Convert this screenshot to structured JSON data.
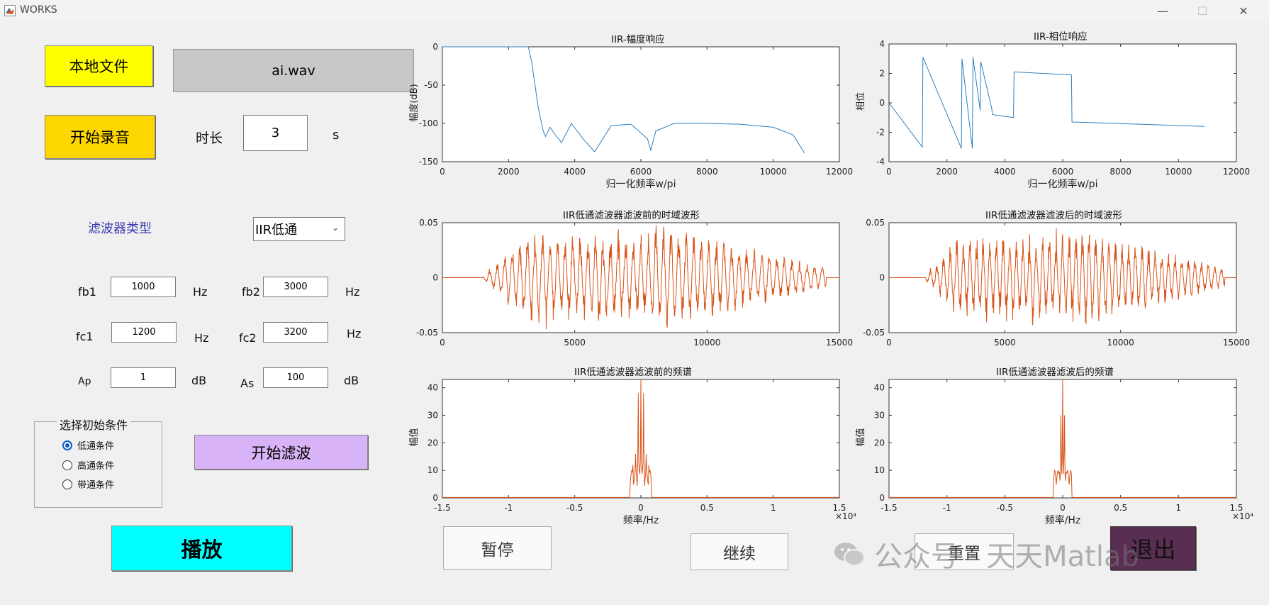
{
  "window": {
    "title": "WORKS",
    "minimize": "—",
    "maximize": "☐",
    "close": "✕"
  },
  "controls": {
    "local_file_button": "本地文件",
    "file_name": "ai.wav",
    "record_button": "开始录音",
    "duration_label": "时长",
    "duration_value": "3",
    "duration_unit": "s",
    "filter_type_label": "滤波器类型",
    "filter_type_selected": "IIR低通",
    "params": {
      "fb1_label": "fb1",
      "fb1_value": "1000",
      "fb1_unit": "Hz",
      "fb2_label": "fb2",
      "fb2_value": "3000",
      "fb2_unit": "Hz",
      "fc1_label": "fc1",
      "fc1_value": "1200",
      "fc1_unit": "Hz",
      "fc2_label": "fc2",
      "fc2_value": "3200",
      "fc2_unit": "Hz",
      "ap_label": "Ap",
      "ap_value": "1",
      "ap_unit": "dB",
      "as_label": "As",
      "as_value": "100",
      "as_unit": "dB"
    },
    "init_group_title": "选择初始条件",
    "init_options": [
      "低通条件",
      "高通条件",
      "带通条件"
    ],
    "init_selected": 0,
    "filter_button": "开始滤波",
    "play_button": "播放",
    "pause_button": "暂停",
    "resume_button": "继续",
    "reset_button": "重置",
    "exit_button": "退出"
  },
  "watermark": {
    "text": "公众号 · 天天Matlab"
  },
  "colors": {
    "blue_line": "#2e7ebc",
    "orange_line": "#d9541a",
    "yellow": "#ffff00",
    "gold": "#ffd700",
    "purple": "#d9b3f7",
    "cyan": "#00ffff",
    "exit_bg": "#5a2d52"
  },
  "chart_data": [
    {
      "type": "line",
      "title": "IIR-幅度响应",
      "xlabel": "归一化频率w/pi",
      "ylabel": "幅度(dB)",
      "xlim": [
        0,
        12000
      ],
      "ylim": [
        -150,
        0
      ],
      "xticks": [
        "0",
        "2000",
        "4000",
        "6000",
        "8000",
        "10000",
        "12000"
      ],
      "yticks": [
        "0",
        "-50",
        "-100",
        "-150"
      ],
      "x": [
        0,
        2600,
        2700,
        2900,
        3050,
        3120,
        3250,
        3380,
        3600,
        3900,
        4250,
        4600,
        5100,
        5700,
        6200,
        6300,
        6450,
        7000,
        8000,
        9000,
        10000,
        10600,
        10950
      ],
      "y": [
        0,
        0,
        -20,
        -80,
        -110,
        -117,
        -105,
        -113,
        -125,
        -100,
        -120,
        -137,
        -103,
        -101,
        -120,
        -135,
        -110,
        -100,
        -100,
        -101,
        -105,
        -115,
        -139
      ]
    },
    {
      "type": "line",
      "title": "IIR-相位响应",
      "xlabel": "归一化频率w/pi",
      "ylabel": "相位",
      "xlim": [
        0,
        12000
      ],
      "ylim": [
        -4,
        4
      ],
      "xticks": [
        "0",
        "2000",
        "4000",
        "6000",
        "8000",
        "10000",
        "12000"
      ],
      "yticks": [
        "4",
        "2",
        "0",
        "-2",
        "-4"
      ],
      "x": [
        0,
        1150,
        1170,
        2500,
        2520,
        2880,
        2900,
        3150,
        3170,
        3550,
        3570,
        4300,
        4320,
        6300,
        6320,
        10900
      ],
      "y": [
        0,
        -3.0,
        3.1,
        -3.1,
        3.0,
        -3.1,
        3.1,
        -0.5,
        2.8,
        -0.4,
        -0.8,
        -1.0,
        2.1,
        1.9,
        -1.3,
        -1.6
      ]
    },
    {
      "type": "line",
      "title": "IIR低通滤波器滤波前的时域波形",
      "xlim": [
        0,
        15000
      ],
      "ylim": [
        -0.05,
        0.05
      ],
      "xticks": [
        "0",
        "5000",
        "10000",
        "15000"
      ],
      "yticks": [
        "0.05",
        "0",
        "-0.05"
      ],
      "envelope": {
        "start": 1500,
        "peak_start": 3000,
        "peak_end": 8000,
        "end": 14500,
        "peak": 0.05,
        "tail": 0.01
      }
    },
    {
      "type": "line",
      "title": "IIR低通滤波器滤波后的时域波形",
      "xlim": [
        0,
        15000
      ],
      "ylim": [
        -0.05,
        0.05
      ],
      "xticks": [
        "0",
        "5000",
        "10000",
        "15000"
      ],
      "yticks": [
        "0.05",
        "0",
        "-0.05"
      ],
      "envelope": {
        "start": 1500,
        "peak_start": 3000,
        "peak_end": 8000,
        "end": 14500,
        "peak": 0.047,
        "tail": 0.009
      }
    },
    {
      "type": "line",
      "title": "IIR低通滤波器滤波前的频谱",
      "xlabel": "频率/Hz",
      "ylabel": "幅值",
      "xlim": [
        -1.5,
        1.5
      ],
      "ylim": [
        0,
        43
      ],
      "x_multiplier": "×10⁴",
      "xticks": [
        "-1.5",
        "-1",
        "-0.5",
        "0",
        "0.5",
        "1",
        "1.5"
      ],
      "yticks": [
        "40",
        "30",
        "20",
        "10",
        "0"
      ],
      "spikes": [
        [
          -0.06,
          12
        ],
        [
          -0.04,
          16
        ],
        [
          -0.02,
          38
        ],
        [
          0,
          43
        ],
        [
          0.02,
          38
        ],
        [
          0.04,
          16
        ],
        [
          0.06,
          12
        ]
      ]
    },
    {
      "type": "line",
      "title": "IIR低通滤波器滤波后的频谱",
      "xlabel": "频率/Hz",
      "ylabel": "幅值",
      "xlim": [
        -1.5,
        1.5
      ],
      "ylim": [
        0,
        43
      ],
      "x_multiplier": "×10⁴",
      "xticks": [
        "-1.5",
        "-1",
        "-0.5",
        "0",
        "0.5",
        "1",
        "1.5"
      ],
      "yticks": [
        "40",
        "30",
        "20",
        "10",
        "0"
      ],
      "spikes": [
        [
          -0.05,
          10
        ],
        [
          -0.03,
          14
        ],
        [
          -0.015,
          36
        ],
        [
          0,
          43
        ],
        [
          0.015,
          36
        ],
        [
          0.03,
          14
        ],
        [
          0.05,
          10
        ]
      ]
    }
  ]
}
